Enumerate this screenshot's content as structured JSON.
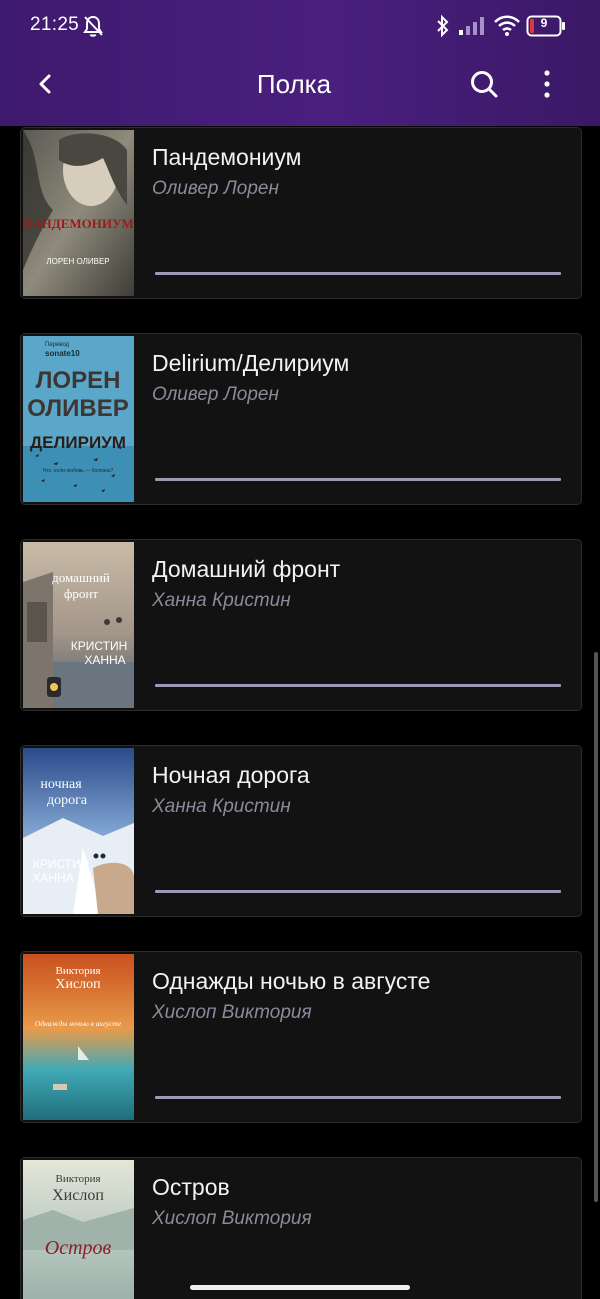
{
  "status_bar": {
    "time": "21:25",
    "battery": "9"
  },
  "toolbar": {
    "title": "Полка"
  },
  "books": [
    {
      "title": "Пандемониум",
      "author": "Оливер Лорен",
      "progress": 1.0
    },
    {
      "title": "Delirium/Делириум",
      "author": "Оливер Лорен",
      "progress": 1.0
    },
    {
      "title": "Домашний фронт",
      "author": "Ханна Кристин",
      "progress": 1.0
    },
    {
      "title": "Ночная дорога",
      "author": "Ханна Кристин",
      "progress": 1.0
    },
    {
      "title": "Однажды ночью в августе",
      "author": "Хислоп Виктория",
      "progress": 1.0
    },
    {
      "title": "Остров",
      "author": "Хислоп Виктория",
      "progress": 1.0
    }
  ],
  "covers": [
    {
      "lines": [
        "ПАНДЕМОНИУМ",
        "ЛОРЕН ОЛИВЕР"
      ],
      "colors": [
        "#6b6a63",
        "#c9c4b3",
        "#9b1b1b"
      ]
    },
    {
      "lines": [
        "Перевод",
        "sonate10",
        "ЛОРЕН",
        "ОЛИВЕР",
        "ДЕЛИРИУМ",
        "Что, если любовь — болезнь?"
      ],
      "colors": [
        "#5aa7c9",
        "#3b2a22"
      ]
    },
    {
      "lines": [
        "домашний",
        "фронт",
        "КРИСТИН",
        "ХАННА"
      ],
      "colors": [
        "#b3a590",
        "#5e6a72"
      ]
    },
    {
      "lines": [
        "ночная",
        "дорога",
        "КРИСТИН",
        "ХАННА"
      ],
      "colors": [
        "#2a4a8a",
        "#8fb2d8"
      ]
    },
    {
      "lines": [
        "Виктория",
        "Хислоп",
        "Однажды ночью в августе"
      ],
      "colors": [
        "#d96a2a",
        "#3fa9b5"
      ]
    },
    {
      "lines": [
        "Виктория",
        "Хислоп",
        "Остров"
      ],
      "colors": [
        "#cfd8cf",
        "#8a1f2a"
      ]
    }
  ]
}
